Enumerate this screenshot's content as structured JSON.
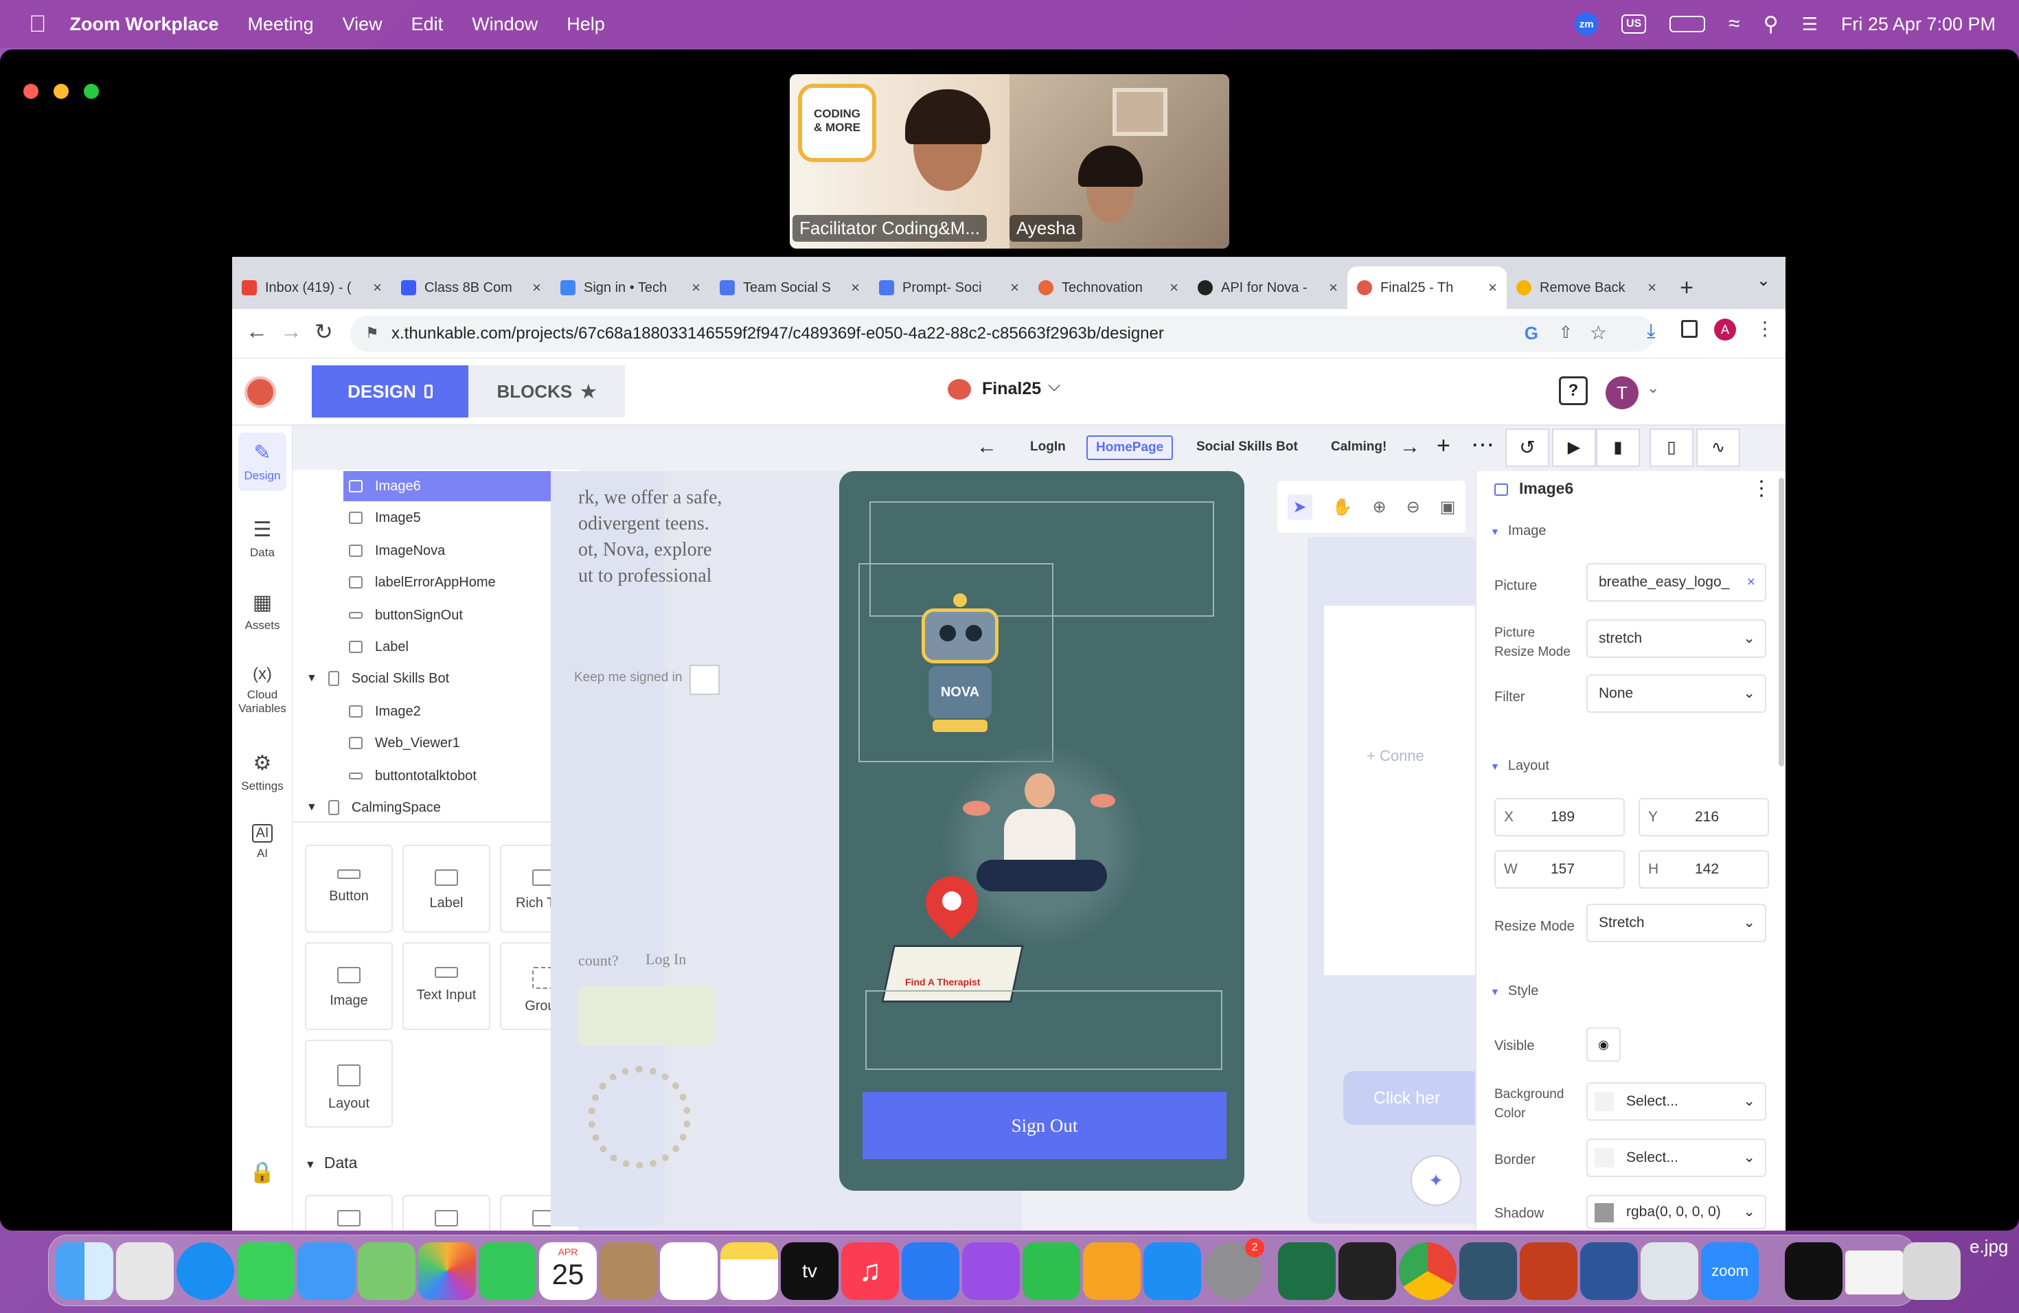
{
  "menubar": {
    "app": "Zoom Workplace",
    "items": [
      "Meeting",
      "View",
      "Edit",
      "Window",
      "Help"
    ],
    "zm": "zm",
    "input": "US",
    "datetime": "Fri 25 Apr  7:00 PM"
  },
  "video": {
    "p1_logo_line1": "CODING",
    "p1_logo_line2": "& MORE",
    "p1_name": "Facilitator Coding&M...",
    "p2_name": "Ayesha"
  },
  "browser": {
    "tabs": [
      "Inbox (419) - (",
      "Class 8B Com",
      "Sign in • Tech",
      "Team Social S",
      "Prompt- Soci",
      "Technovation",
      "API for Nova -",
      "Final25 - Th",
      "Remove Back"
    ],
    "url": "x.thunkable.com/projects/67c68a188033146559f2f947/c489369f-e050-4a22-88c2-c85663f2963b/designer",
    "profile": "A"
  },
  "app": {
    "design": "DESIGN",
    "blocks": "BLOCKS",
    "project": "Final25",
    "avatar": "T",
    "rail": [
      "Design",
      "Data",
      "Assets",
      "Cloud Variables",
      "Settings",
      "AI"
    ],
    "pages": {
      "login": "LogIn",
      "home": "HomePage",
      "social": "Social Skills Bot",
      "calming": "Calming!"
    },
    "tree": [
      {
        "label": "Image6",
        "kind": "image"
      },
      {
        "label": "Image5",
        "kind": "image"
      },
      {
        "label": "ImageNova",
        "kind": "image"
      },
      {
        "label": "labelErrorAppHome",
        "kind": "label"
      },
      {
        "label": "buttonSignOut",
        "kind": "button"
      },
      {
        "label": "Label",
        "kind": "label"
      },
      {
        "label": "Social Skills Bot",
        "kind": "screen"
      },
      {
        "label": "Image2",
        "kind": "image"
      },
      {
        "label": "Web_Viewer1",
        "kind": "web"
      },
      {
        "label": "buttontotalktobot",
        "kind": "button"
      },
      {
        "label": "CalmingSpace",
        "kind": "screen"
      }
    ],
    "palette": [
      "Button",
      "Label",
      "Rich Text",
      "Image",
      "Text Input",
      "Group",
      "Layout"
    ],
    "data_section": "Data",
    "bg_text": [
      "rk, we offer a safe,",
      "odivergent teens.",
      "ot, Nova, explore",
      "ut to professional"
    ],
    "keep_signed": "Keep me signed in",
    "account_q": "count?",
    "login_link": "Log In",
    "signout": "Sign Out",
    "find_therapist": "Find A Therapist",
    "nova_label": "NOVA",
    "connect_hint": "+ Conne",
    "click_here": "Click her"
  },
  "props": {
    "title": "Image6",
    "image_section": "Image",
    "picture_label": "Picture",
    "picture_value": "breathe_easy_logo_",
    "resize_label": "Picture Resize Mode",
    "resize_value": "stretch",
    "filter_label": "Filter",
    "filter_value": "None",
    "layout_section": "Layout",
    "x_label": "X",
    "x": "189",
    "y_label": "Y",
    "y": "216",
    "w_label": "W",
    "w": "157",
    "h_label": "H",
    "h": "142",
    "resize_mode_label": "Resize Mode",
    "resize_mode_value": "Stretch",
    "style_section": "Style",
    "visible_label": "Visible",
    "bg_label": "Background Color",
    "bg_value": "Select...",
    "border_label": "Border",
    "border_value": "Select...",
    "shadow_label": "Shadow",
    "shadow_value": "rgba(0, 0, 0, 0)"
  },
  "dock": {
    "calendar_month": "APR",
    "calendar_day": "25",
    "settings_badge": "2",
    "zoom": "zoom",
    "file": "e.jpg"
  }
}
